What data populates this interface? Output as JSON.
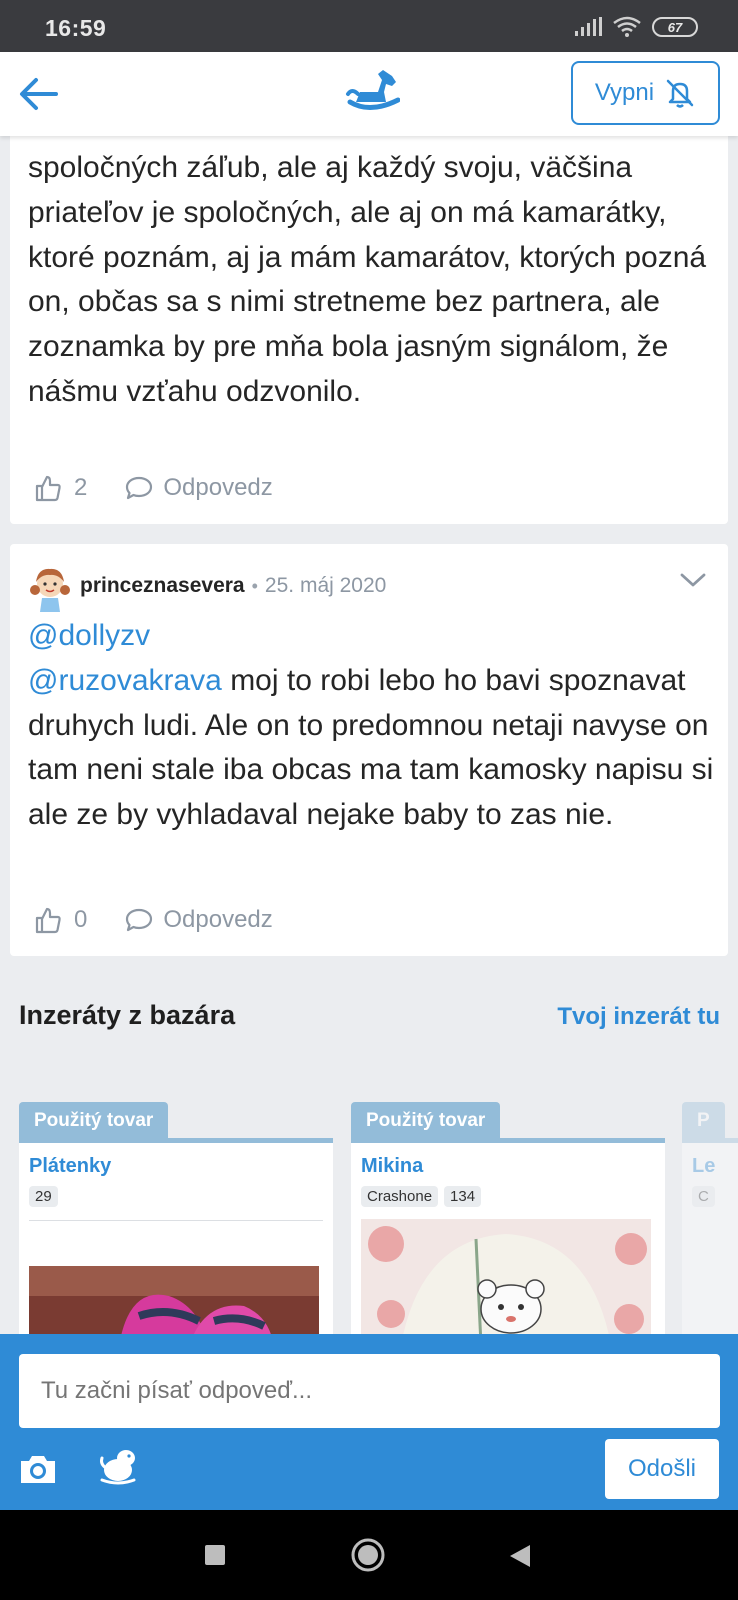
{
  "status_bar": {
    "time": "16:59",
    "battery": "67"
  },
  "header": {
    "mute_label": "Vypni"
  },
  "comment1": {
    "text": "spoločných záľub, ale aj každý svoju, väčšina priateľov je spoločných, ale aj on má kamarátky, ktoré poznám, aj ja mám kamarátov, ktorých pozná on, občas sa s nimi stretneme bez partnera, ale zoznamka by pre mňa bola jasným signálom, že nášmu vzťahu odzvonilo.",
    "likes": "2",
    "reply_label": "Odpovedz"
  },
  "comment2": {
    "author": "princeznasevera",
    "separator": "•",
    "date": "25. máj 2020",
    "mention1": "@dollyzv",
    "mention2": "@ruzovakrava",
    "text": " moj to robi lebo ho bavi spoznavat druhych ludi. Ale on to predomnou netaji navyse on tam neni stale iba obcas ma tam kamosky napisu si ale ze by vyhladaval nejake baby to zas nie.",
    "likes": "0",
    "reply_label": "Odpovedz"
  },
  "bazaar": {
    "title": "Inzeráty z bazára",
    "link": "Tvoj inzerát tu",
    "ads": [
      {
        "tag": "Použitý tovar",
        "title": "Plátenky",
        "chips": [
          "29"
        ]
      },
      {
        "tag": "Použitý tovar",
        "title": "Mikina",
        "chips": [
          "Crashone",
          "134"
        ]
      },
      {
        "tag": "P",
        "title": "Le",
        "chips": [
          "C"
        ]
      }
    ]
  },
  "composer": {
    "placeholder": "Tu začni písať odpoveď...",
    "send_label": "Odošli"
  },
  "colors": {
    "accent": "#2f8bd6",
    "tag": "#93bcd9",
    "background": "#ebedf0"
  },
  "icons": [
    "back-arrow-icon",
    "rocking-horse-logo",
    "bell-off-icon",
    "thumbs-up-icon",
    "comment-icon",
    "chevron-down-icon",
    "camera-icon",
    "sticker-icon"
  ]
}
